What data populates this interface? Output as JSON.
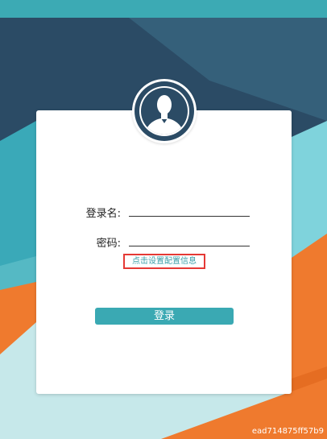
{
  "form": {
    "username_label": "登录名:",
    "password_label": "密码:",
    "username_value": "",
    "password_value": "",
    "config_link": "点击设置配置信息",
    "login_button": "登录"
  },
  "watermark": "ead714875ff57b9",
  "colors": {
    "accent": "#3aa9b3",
    "dark_navy": "#2b4b65",
    "orange": "#ef7a2e",
    "highlight_border": "#e53935"
  },
  "icons": {
    "avatar": "user-silhouette-icon"
  }
}
